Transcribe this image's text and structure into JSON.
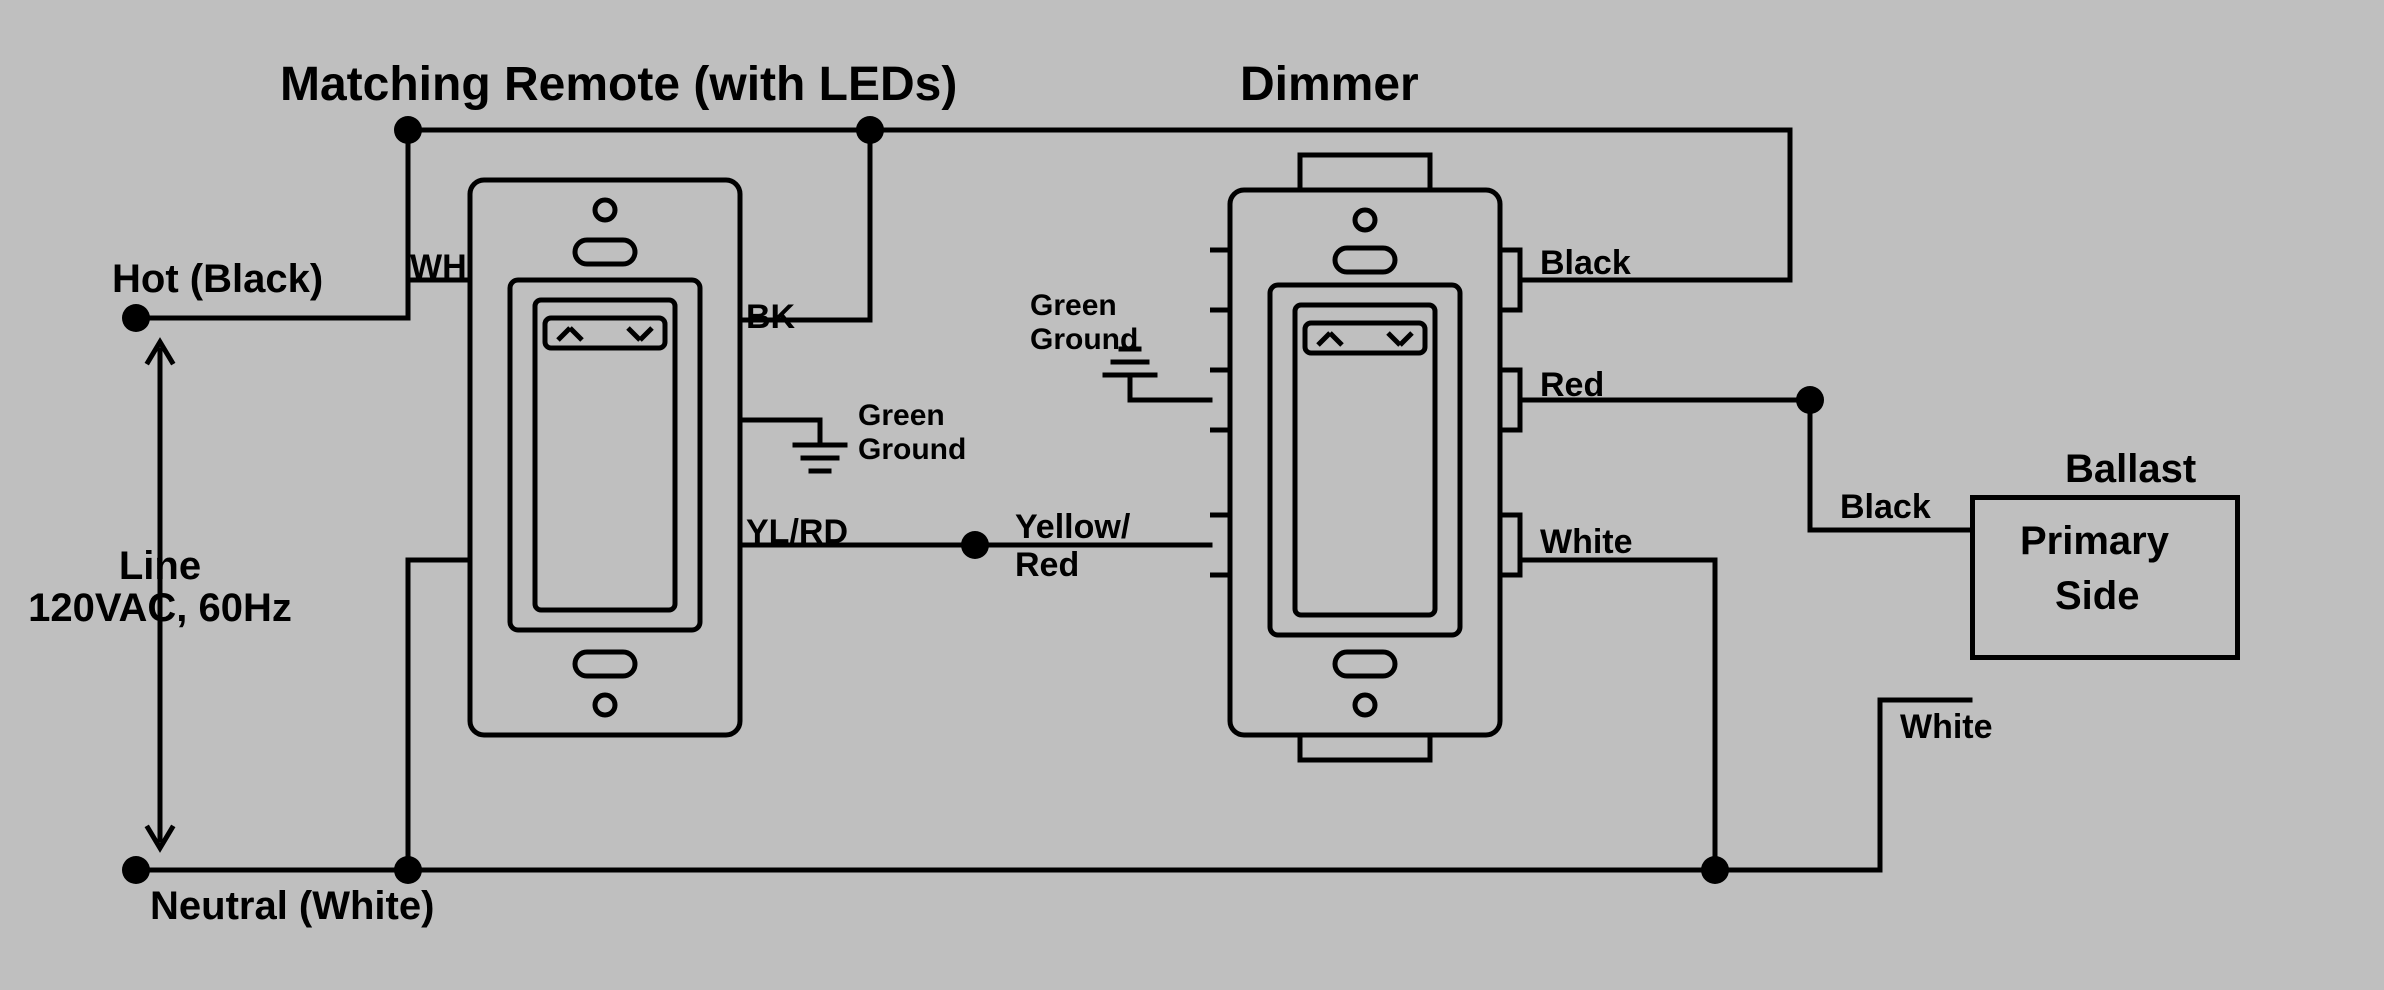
{
  "titles": {
    "remote": "Matching Remote (with LEDs)",
    "dimmer": "Dimmer"
  },
  "source": {
    "hot": "Hot (Black)",
    "line": "Line\n120VAC, 60Hz",
    "neutral": "Neutral (White)"
  },
  "remote_terminals": {
    "wh": "WH",
    "bk": "BK",
    "ylrd": "YL/RD",
    "ground_top": "Green",
    "ground_bottom": "Ground"
  },
  "dimmer_terminals": {
    "ylrd_top": "Yellow/",
    "ylrd_bottom": "Red",
    "ground_top": "Green",
    "ground_bottom": "Ground",
    "black": "Black",
    "red": "Red",
    "white": "White"
  },
  "ballast": {
    "title": "Ballast",
    "black": "Black",
    "white": "White",
    "box_top": "Primary",
    "box_bottom": "Side"
  }
}
